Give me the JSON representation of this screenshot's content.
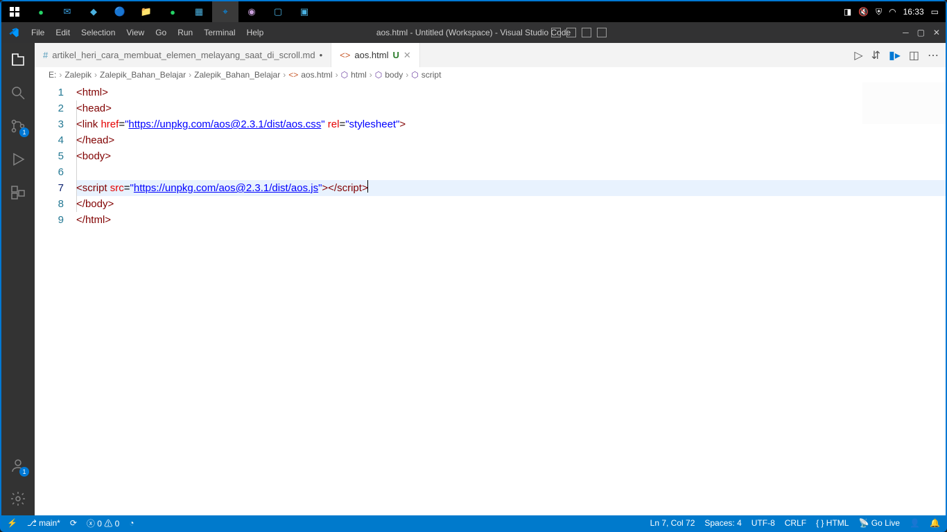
{
  "os": {
    "clock": "16:33"
  },
  "vscode": {
    "menus": [
      "File",
      "Edit",
      "Selection",
      "View",
      "Go",
      "Run",
      "Terminal",
      "Help"
    ],
    "windowTitle": "aos.html - Untitled (Workspace) - Visual Studio Code",
    "activity": {
      "scmBadge": "1",
      "accountBadge": "1"
    },
    "tabs": [
      {
        "label": "artikel_heri_cara_membuat_elemen_melayang_saat_di_scroll.md",
        "modified": "•",
        "active": false
      },
      {
        "label": "aos.html",
        "status": "U",
        "active": true
      }
    ],
    "breadcrumbs": {
      "drive": "E:",
      "parts": [
        "Zalepik",
        "Zalepik_Bahan_Belajar",
        "Zalepik_Bahan_Belajar"
      ],
      "file": "aos.html",
      "symbols": [
        "html",
        "body",
        "script"
      ]
    },
    "code": {
      "lines": [
        {
          "n": "1",
          "indent": 0,
          "tokens": [
            {
              "t": "t-pun",
              "v": "<"
            },
            {
              "t": "t-tag",
              "v": "html"
            },
            {
              "t": "t-pun",
              "v": ">"
            }
          ]
        },
        {
          "n": "2",
          "indent": 1,
          "tokens": [
            {
              "t": "t-pun",
              "v": "<"
            },
            {
              "t": "t-tag",
              "v": "head"
            },
            {
              "t": "t-pun",
              "v": ">"
            }
          ]
        },
        {
          "n": "3",
          "indent": 2,
          "tokens": [
            {
              "t": "t-pun",
              "v": "<"
            },
            {
              "t": "t-tag",
              "v": "link"
            },
            {
              "t": "",
              "v": " "
            },
            {
              "t": "t-attr",
              "v": "href"
            },
            {
              "t": "",
              "v": "="
            },
            {
              "t": "t-str",
              "v": "\""
            },
            {
              "t": "t-link",
              "v": "https://unpkg.com/aos@2.3.1/dist/aos.css"
            },
            {
              "t": "t-str",
              "v": "\""
            },
            {
              "t": "",
              "v": " "
            },
            {
              "t": "t-attr",
              "v": "rel"
            },
            {
              "t": "",
              "v": "="
            },
            {
              "t": "t-str",
              "v": "\"stylesheet\""
            },
            {
              "t": "t-pun",
              "v": ">"
            }
          ]
        },
        {
          "n": "4",
          "indent": 1,
          "tokens": [
            {
              "t": "t-pun",
              "v": "</"
            },
            {
              "t": "t-tag",
              "v": "head"
            },
            {
              "t": "t-pun",
              "v": ">"
            }
          ]
        },
        {
          "n": "5",
          "indent": 1,
          "tokens": [
            {
              "t": "t-pun",
              "v": "<"
            },
            {
              "t": "t-tag",
              "v": "body"
            },
            {
              "t": "t-pun",
              "v": ">"
            }
          ]
        },
        {
          "n": "6",
          "indent": 2,
          "tokens": []
        },
        {
          "n": "7",
          "indent": 2,
          "cur": true,
          "tokens": [
            {
              "t": "t-pun",
              "v": "<"
            },
            {
              "t": "t-tag",
              "v": "script"
            },
            {
              "t": "",
              "v": " "
            },
            {
              "t": "t-attr",
              "v": "src"
            },
            {
              "t": "",
              "v": "="
            },
            {
              "t": "t-str",
              "v": "\""
            },
            {
              "t": "t-link",
              "v": "https://unpkg.com/aos@2.3.1/dist/aos.js"
            },
            {
              "t": "t-str",
              "v": "\""
            },
            {
              "t": "t-pun",
              "v": "></"
            },
            {
              "t": "t-tag",
              "v": "script"
            },
            {
              "t": "t-pun",
              "v": ">"
            }
          ]
        },
        {
          "n": "8",
          "indent": 1,
          "tokens": [
            {
              "t": "t-pun",
              "v": "</"
            },
            {
              "t": "t-tag",
              "v": "body"
            },
            {
              "t": "t-pun",
              "v": ">"
            }
          ]
        },
        {
          "n": "9",
          "indent": 0,
          "tokens": [
            {
              "t": "t-pun",
              "v": "</"
            },
            {
              "t": "t-tag",
              "v": "html"
            },
            {
              "t": "t-pun",
              "v": ">"
            }
          ]
        }
      ]
    },
    "status": {
      "branch": "main*",
      "sync": "",
      "errors": "0",
      "warnings": "0",
      "cursor": "Ln 7, Col 72",
      "spaces": "Spaces: 4",
      "encoding": "UTF-8",
      "eol": "CRLF",
      "lang": "HTML",
      "golive": "Go Live"
    }
  }
}
